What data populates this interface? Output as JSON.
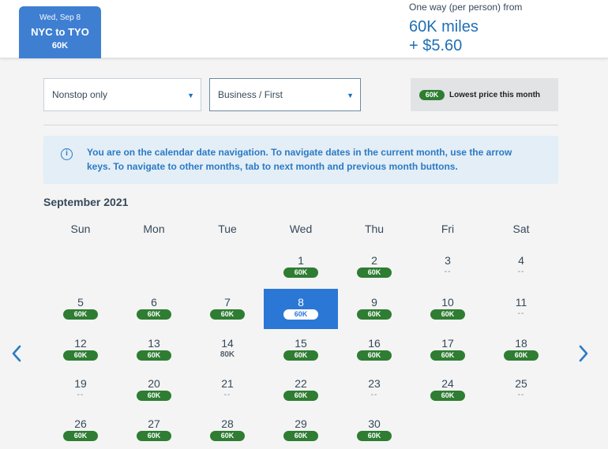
{
  "trip_tab": {
    "date": "Wed, Sep 8",
    "route": "NYC to TYO",
    "miles": "60K"
  },
  "price_summary": {
    "label": "One way (per person) from",
    "miles": "60K miles",
    "fee": "+ $5.60"
  },
  "filters": {
    "stops": {
      "value": "Nonstop only"
    },
    "cabin": {
      "value": "Business / First"
    }
  },
  "legend": {
    "badge": "60K",
    "text": "Lowest price this month"
  },
  "info": {
    "text": "You are on the calendar date navigation. To navigate dates in the current month, use the arrow keys. To navigate to other months, tab to next month and previous month buttons."
  },
  "calendar": {
    "month": "September 2021",
    "weekdays": [
      "Sun",
      "Mon",
      "Tue",
      "Wed",
      "Thu",
      "Fri",
      "Sat"
    ],
    "selected_day": "8",
    "weeks": [
      [
        null,
        null,
        null,
        {
          "day": "1",
          "price": "60K",
          "lowest": true
        },
        {
          "day": "2",
          "price": "60K",
          "lowest": true
        },
        {
          "day": "3",
          "price": "--",
          "lowest": false
        },
        {
          "day": "4",
          "price": "--",
          "lowest": false
        }
      ],
      [
        {
          "day": "5",
          "price": "60K",
          "lowest": true
        },
        {
          "day": "6",
          "price": "60K",
          "lowest": true
        },
        {
          "day": "7",
          "price": "60K",
          "lowest": true
        },
        {
          "day": "8",
          "price": "60K",
          "lowest": true
        },
        {
          "day": "9",
          "price": "60K",
          "lowest": true
        },
        {
          "day": "10",
          "price": "60K",
          "lowest": true
        },
        {
          "day": "11",
          "price": "--",
          "lowest": false
        }
      ],
      [
        {
          "day": "12",
          "price": "60K",
          "lowest": true
        },
        {
          "day": "13",
          "price": "60K",
          "lowest": true
        },
        {
          "day": "14",
          "price": "80K",
          "lowest": false
        },
        {
          "day": "15",
          "price": "60K",
          "lowest": true
        },
        {
          "day": "16",
          "price": "60K",
          "lowest": true
        },
        {
          "day": "17",
          "price": "60K",
          "lowest": true
        },
        {
          "day": "18",
          "price": "60K",
          "lowest": true
        }
      ],
      [
        {
          "day": "19",
          "price": "--",
          "lowest": false
        },
        {
          "day": "20",
          "price": "60K",
          "lowest": true
        },
        {
          "day": "21",
          "price": "--",
          "lowest": false
        },
        {
          "day": "22",
          "price": "60K",
          "lowest": true
        },
        {
          "day": "23",
          "price": "--",
          "lowest": false
        },
        {
          "day": "24",
          "price": "60K",
          "lowest": true
        },
        {
          "day": "25",
          "price": "--",
          "lowest": false
        }
      ],
      [
        {
          "day": "26",
          "price": "60K",
          "lowest": true
        },
        {
          "day": "27",
          "price": "60K",
          "lowest": true
        },
        {
          "day": "28",
          "price": "60K",
          "lowest": true
        },
        {
          "day": "29",
          "price": "60K",
          "lowest": true
        },
        {
          "day": "30",
          "price": "60K",
          "lowest": true
        },
        null,
        null
      ]
    ]
  },
  "colors": {
    "accent": "#2b77d6",
    "lowest_badge": "#2e7d32",
    "info_bg": "#e3eef7"
  },
  "icons": {
    "prev": "chevron-left-icon",
    "next": "chevron-right-icon",
    "info": "info-circle-icon",
    "dropdown": "caret-down-icon"
  }
}
